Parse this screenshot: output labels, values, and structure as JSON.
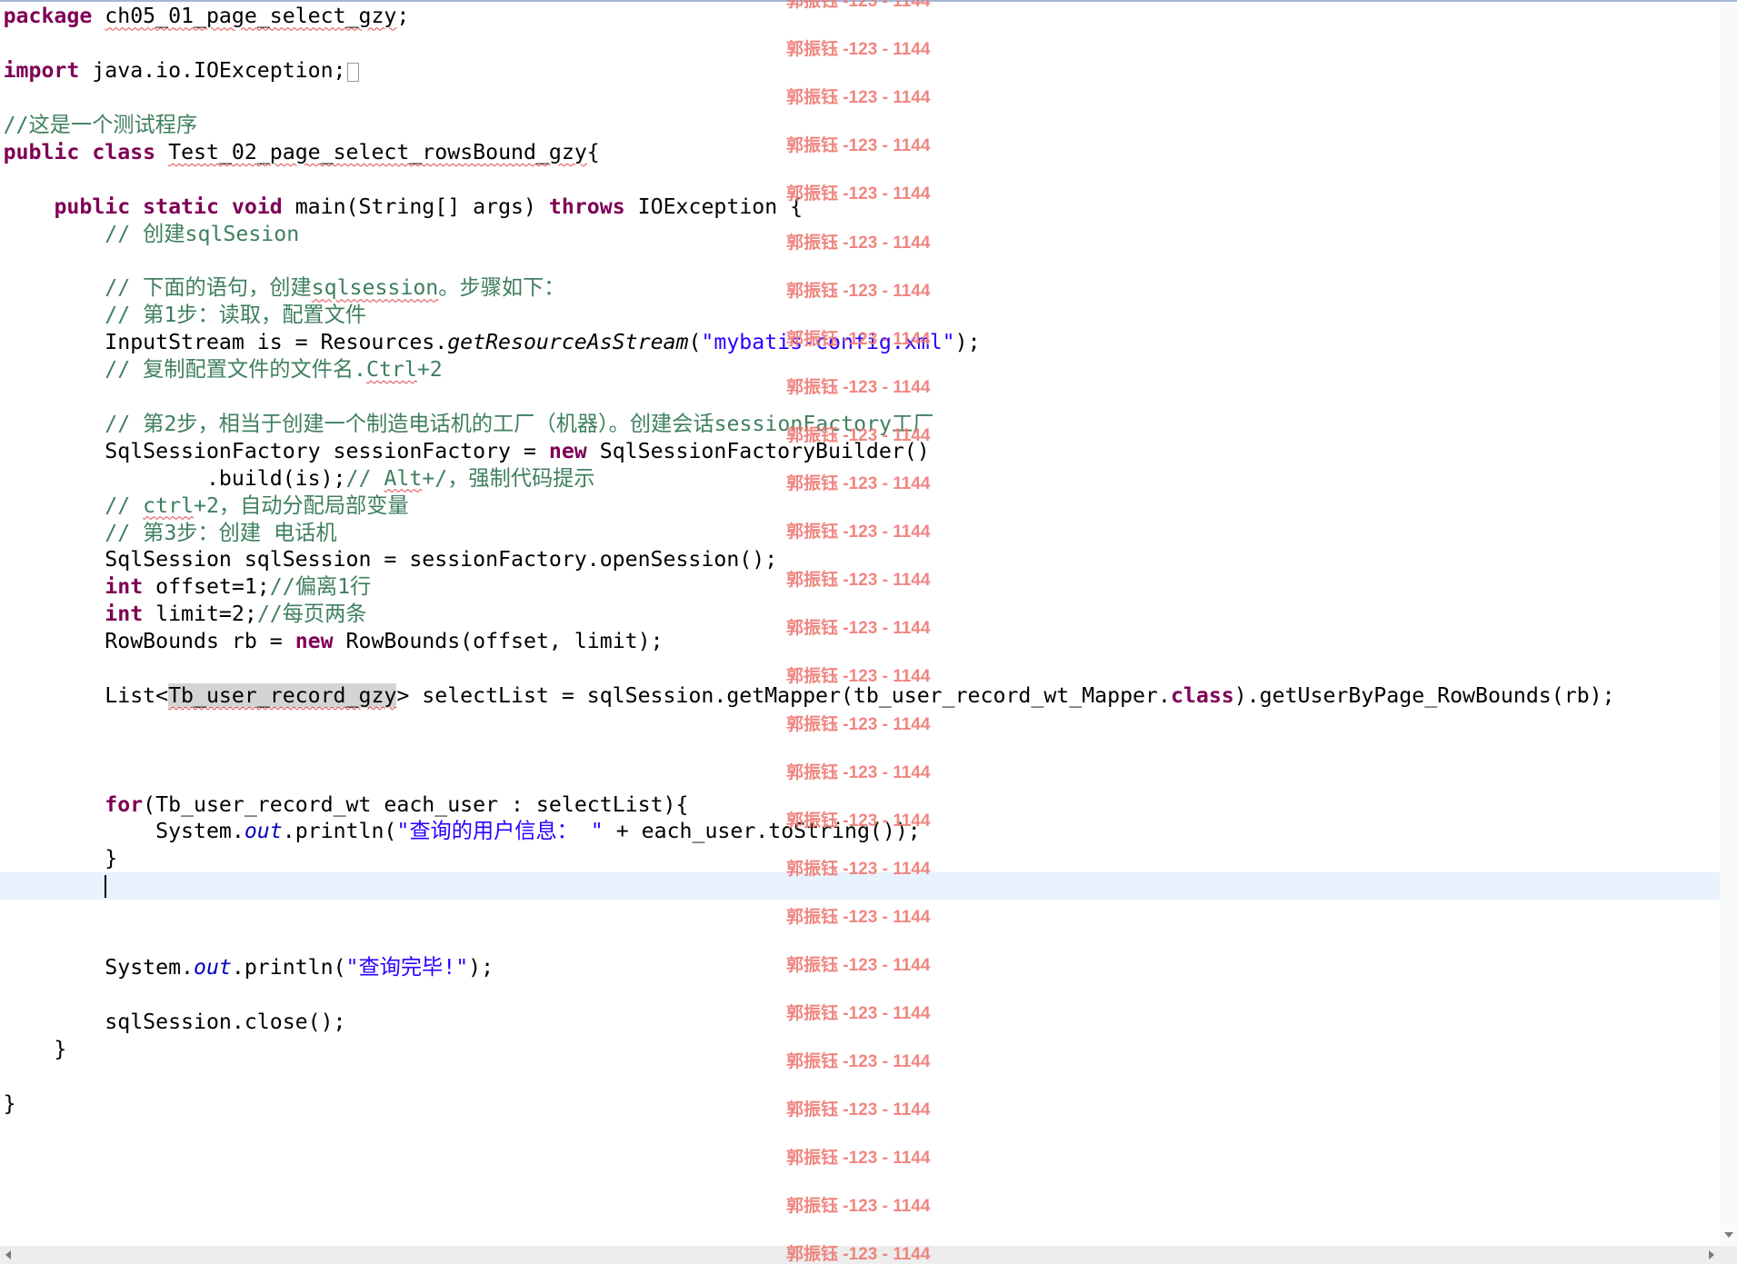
{
  "syntax_colors": {
    "keyword": "#7f0055",
    "comment": "#3f7f5f",
    "string": "#2a00ff",
    "static_field": "#0000c0",
    "text": "#000000",
    "current_line": "#e8f2fe",
    "occurrence": "#d4d4d4",
    "spelling_underline": "#e04848"
  },
  "editor": {
    "cursor_line": 33
  },
  "icons": {
    "fold_marker": "folded-code-box-icon",
    "scroll_down": "scroll-down-arrow-icon",
    "scroll_left": "scroll-left-arrow-icon",
    "scroll_right": "scroll-right-arrow-icon"
  },
  "code": {
    "lines": [
      [
        {
          "keyword": "package"
        },
        {
          "text": " "
        },
        {
          "misspelled": "ch05_01_page_select_gzy"
        },
        {
          "text": ";"
        }
      ],
      [],
      [
        {
          "keyword": "import"
        },
        {
          "text": " java.io.IOException;"
        },
        {
          "fold_marker": true
        }
      ],
      [],
      [
        {
          "comment": "//这是一个测试程序"
        }
      ],
      [
        {
          "keyword": "public"
        },
        {
          "text": " "
        },
        {
          "keyword": "class"
        },
        {
          "text": " "
        },
        {
          "misspelled": "Test_02_page_select_rowsBound_gzy"
        },
        {
          "text": "{"
        }
      ],
      [],
      [
        {
          "text": "    "
        },
        {
          "keyword": "public"
        },
        {
          "text": " "
        },
        {
          "keyword": "static"
        },
        {
          "text": " "
        },
        {
          "keyword": "void"
        },
        {
          "text": " main(String[] args) "
        },
        {
          "keyword": "throws"
        },
        {
          "text": " IOException {"
        }
      ],
      [
        {
          "text": "        "
        },
        {
          "comment": "// 创建sqlSesion"
        }
      ],
      [],
      [
        {
          "text": "        "
        },
        {
          "comment": "// 下面的语句，创建"
        },
        {
          "comment_misspelled": "sqlsession"
        },
        {
          "comment": "。步骤如下："
        }
      ],
      [
        {
          "text": "        "
        },
        {
          "comment": "// 第1步：读取，配置文件"
        }
      ],
      [
        {
          "text": "        InputStream is = Resources."
        },
        {
          "static_method": "getResourceAsStream"
        },
        {
          "text": "("
        },
        {
          "string": "\"mybatis-config.xml\""
        },
        {
          "text": ");"
        }
      ],
      [
        {
          "text": "        "
        },
        {
          "comment": "// 复制配置文件的文件名."
        },
        {
          "comment_misspelled": "Ctrl"
        },
        {
          "comment": "+2"
        }
      ],
      [],
      [
        {
          "text": "        "
        },
        {
          "comment": "// 第2步，相当于创建一个制造电话机的工厂（机器）。创建会话sessionFactory工厂"
        }
      ],
      [
        {
          "text": "        SqlSessionFactory sessionFactory = "
        },
        {
          "keyword": "new"
        },
        {
          "text": " SqlSessionFactoryBuilder()"
        }
      ],
      [
        {
          "text": "                .build(is);"
        },
        {
          "comment": "// "
        },
        {
          "comment_misspelled": "Alt"
        },
        {
          "comment": "+/，强制代码提示"
        }
      ],
      [
        {
          "text": "        "
        },
        {
          "comment": "// "
        },
        {
          "comment_misspelled": "ctrl"
        },
        {
          "comment": "+2，自动分配局部变量"
        }
      ],
      [
        {
          "text": "        "
        },
        {
          "comment": "// 第3步：创建 电话机"
        }
      ],
      [
        {
          "text": "        SqlSession sqlSession = sessionFactory.openSession();"
        }
      ],
      [
        {
          "text": "        "
        },
        {
          "keyword": "int"
        },
        {
          "text": " offset=1;"
        },
        {
          "comment": "//偏离1行"
        }
      ],
      [
        {
          "text": "        "
        },
        {
          "keyword": "int"
        },
        {
          "text": " limit=2;"
        },
        {
          "comment": "//每页两条"
        }
      ],
      [
        {
          "text": "        RowBounds rb = "
        },
        {
          "keyword": "new"
        },
        {
          "text": " RowBounds(offset, limit);"
        }
      ],
      [],
      [
        {
          "text": "        List<"
        },
        {
          "occurrence": "Tb_user_record_gzy"
        },
        {
          "text": "> selectList = sqlSession.getMapper(tb_user_record_wt_Mapper."
        },
        {
          "keyword": "class"
        },
        {
          "text": ").getUserByPage_RowBounds(rb);"
        }
      ],
      [],
      [],
      [],
      [
        {
          "text": "        "
        },
        {
          "keyword": "for"
        },
        {
          "text": "(Tb_user_record_wt each_user : selectList){"
        }
      ],
      [
        {
          "text": "            System."
        },
        {
          "static_field": "out"
        },
        {
          "text": ".println("
        },
        {
          "string": "\"查询的用户信息： \""
        },
        {
          "text": " + each_user.toString());"
        }
      ],
      [
        {
          "text": "        }"
        }
      ],
      [
        {
          "text": "        "
        }
      ],
      [],
      [],
      [
        {
          "text": "        System."
        },
        {
          "static_field": "out"
        },
        {
          "text": ".println("
        },
        {
          "string": "\"查询完毕!\""
        },
        {
          "text": ");"
        }
      ],
      [],
      [
        {
          "text": "        sqlSession.close();"
        }
      ],
      [
        {
          "text": "    }"
        }
      ],
      [],
      [
        {
          "text": "}"
        }
      ]
    ]
  },
  "watermark": {
    "text": "郭振钰 -123 - 1144",
    "color": "#ef7a74"
  }
}
